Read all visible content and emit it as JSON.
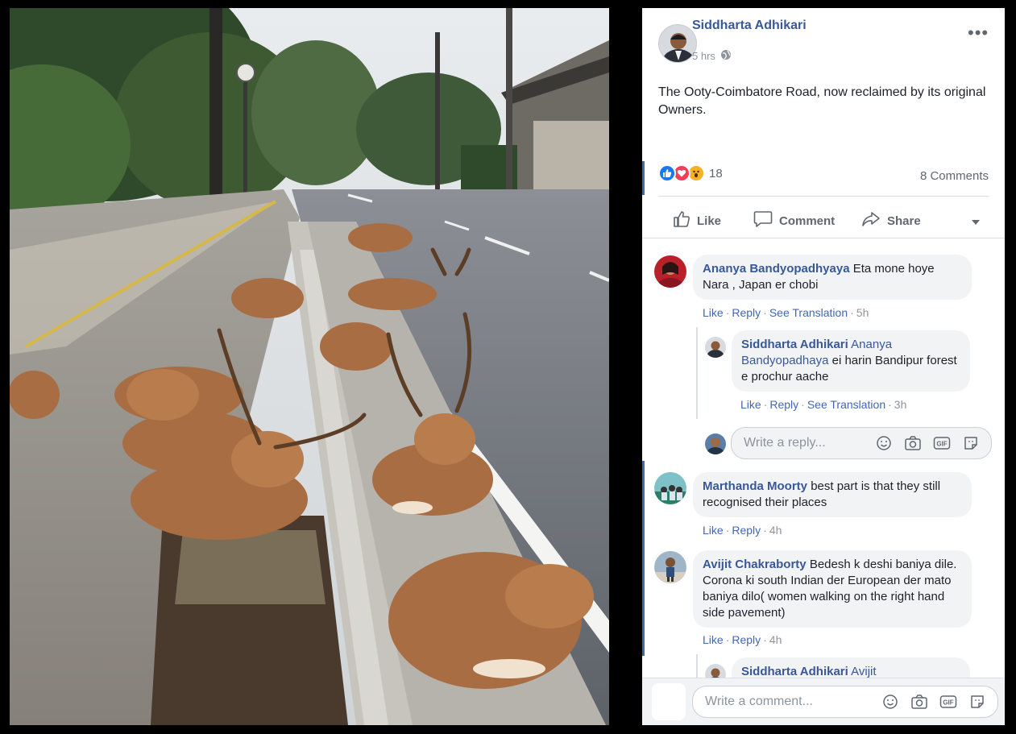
{
  "post": {
    "author": "Siddharta Adhikari",
    "time": "5 hrs",
    "privacy_icon": "globe-icon",
    "text": "The Ooty-Coimbatore Road, now reclaimed by its original Owners.",
    "reaction_count": "18",
    "reaction_icons": [
      "like-icon",
      "love-icon",
      "wow-icon"
    ],
    "comments_count_label": "8 Comments",
    "actions": {
      "like": "Like",
      "comment": "Comment",
      "share": "Share"
    }
  },
  "comments": [
    {
      "author": "Ananya Bandyopadhyaya",
      "text": "Eta mone hoye Nara , Japan er chobi",
      "like": "Like",
      "reply": "Reply",
      "translate": "See Translation",
      "time": "5h",
      "replies": [
        {
          "author": "Siddharta Adhikari",
          "tag": "Ananya Bandyopadhaya",
          "text": "ei harin Bandipur forest e prochur aache",
          "like": "Like",
          "reply": "Reply",
          "translate": "See Translation",
          "time": "3h"
        }
      ],
      "reply_placeholder": "Write a reply..."
    },
    {
      "author": "Marthanda Moorty",
      "text": "best part is that they still recognised their places",
      "like": "Like",
      "reply": "Reply",
      "time": "4h"
    },
    {
      "author": "Avijit Chakraborty",
      "text": "Bedesh k deshi baniya dile. Corona ki south Indian der European der mato baniya dilo( women walking on the right hand side pavement)",
      "like": "Like",
      "reply": "Reply",
      "time": "4h",
      "replies": [
        {
          "author": "Siddharta Adhikari",
          "tag": "Avijit"
        }
      ]
    }
  ],
  "composer": {
    "placeholder": "Write a comment..."
  },
  "colors": {
    "link": "#385898",
    "accent": "#4267b2",
    "bubble": "#f2f3f5",
    "muted": "#606770"
  }
}
